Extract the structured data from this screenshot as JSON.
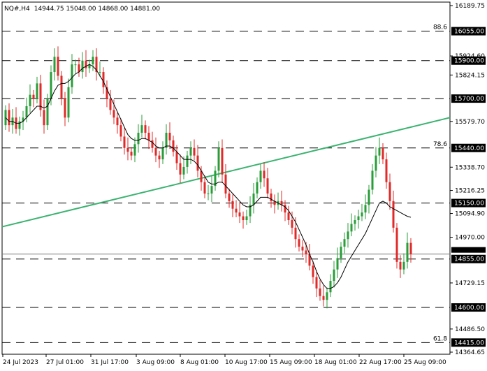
{
  "header": {
    "symbol_timeframe": "NQ#,H4",
    "ohlc": "14944.75 15048.00 14868.00 14881.00"
  },
  "colors": {
    "bull": "#2a9d3a",
    "bear": "#e02a2a",
    "trendline": "#3cb371",
    "ma": "#000000",
    "level_line": "#000000",
    "level_label_bg": "#000000",
    "level_label_text": "#ffffff"
  },
  "axis": {
    "price_ticks": [
      "16189.75",
      "15924.60",
      "15824.15",
      "15579.70",
      "15338.70",
      "15216.25",
      "15094.90",
      "14970.00",
      "14729.15",
      "14486.50",
      "14364.65"
    ],
    "date_ticks": [
      "24 Jul 2023",
      "27 Jul 01:00",
      "31 Jul 17:00",
      "3 Aug 09:00",
      "8 Aug 01:00",
      "10 Aug 17:00",
      "15 Aug 09:00",
      "18 Aug 01:00",
      "22 Aug 17:00",
      "25 Aug 09:00"
    ]
  },
  "levels": [
    {
      "price": "16055.00",
      "fib": "88.6"
    },
    {
      "price": "15900.00",
      "fib": ""
    },
    {
      "price": "15700.00",
      "fib": ""
    },
    {
      "price": "15440.00",
      "fib": "78.6"
    },
    {
      "price": "15150.00",
      "fib": ""
    },
    {
      "price": "14855.00",
      "fib": ""
    },
    {
      "price": "14600.00",
      "fib": ""
    },
    {
      "price": "14415.00",
      "fib": "61.8"
    }
  ],
  "current_price": "14881.00",
  "chart_data": {
    "type": "candlestick",
    "title": "NQ#,H4",
    "ylim": [
      14364.65,
      16189.75
    ],
    "closes": [
      15640,
      15560,
      15600,
      15540,
      15580,
      15600,
      15660,
      15720,
      15700,
      15780,
      15640,
      15560,
      15700,
      15840,
      15920,
      15820,
      15700,
      15600,
      15760,
      15880,
      15880,
      15840,
      15900,
      15860,
      15880,
      15920,
      15840,
      15840,
      15760,
      15700,
      15640,
      15600,
      15560,
      15500,
      15440,
      15420,
      15400,
      15460,
      15520,
      15560,
      15520,
      15480,
      15440,
      15400,
      15380,
      15440,
      15520,
      15480,
      15420,
      15360,
      15300,
      15340,
      15400,
      15440,
      15400,
      15320,
      15260,
      15200,
      15200,
      15240,
      15320,
      15440,
      15300,
      15200,
      15160,
      15120,
      15100,
      15080,
      15060,
      15080,
      15140,
      15200,
      15260,
      15320,
      15280,
      15200,
      15160,
      15140,
      15160,
      15140,
      15100,
      15060,
      15020,
      14960,
      14920,
      14900,
      14880,
      14820,
      14760,
      14700,
      14660,
      14640,
      14680,
      14740,
      14800,
      14860,
      14920,
      14960,
      15000,
      15040,
      15060,
      15080,
      15100,
      15140,
      15220,
      15320,
      15400,
      15440,
      15380,
      15260,
      15160,
      15020,
      14840,
      14800,
      14840,
      14940,
      14881
    ],
    "ma_values": [
      15600,
      15580,
      15580,
      15570,
      15570,
      15580,
      15600,
      15620,
      15640,
      15660,
      15660,
      15650,
      15660,
      15700,
      15740,
      15770,
      15780,
      15780,
      15790,
      15810,
      15830,
      15840,
      15860,
      15870,
      15880,
      15870,
      15850,
      15820,
      15790,
      15750,
      15710,
      15670,
      15630,
      15590,
      15550,
      15510,
      15490,
      15480,
      15480,
      15490,
      15490,
      15480,
      15470,
      15450,
      15440,
      15440,
      15450,
      15450,
      15440,
      15420,
      15400,
      15380,
      15380,
      15380,
      15370,
      15350,
      15320,
      15290,
      15260,
      15250,
      15250,
      15260,
      15260,
      15240,
      15220,
      15200,
      15180,
      15160,
      15140,
      15130,
      15130,
      15140,
      15160,
      15180,
      15180,
      15180,
      15170,
      15160,
      15150,
      15140,
      15130,
      15110,
      15080,
      15050,
      15010,
      14970,
      14930,
      14880,
      14840,
      14790,
      14750,
      14720,
      14700,
      14700,
      14710,
      14730,
      14760,
      14800,
      14840,
      14870,
      14900,
      14930,
      14960,
      14990,
      15030,
      15070,
      15110,
      15150,
      15160,
      15150,
      15130,
      15120,
      15110,
      15100,
      15090,
      15080,
      15075
    ],
    "trendline": {
      "from": 15025,
      "to": 15600
    },
    "x_ticks": [
      "24 Jul 2023",
      "27 Jul 01:00",
      "31 Jul 17:00",
      "3 Aug 09:00",
      "8 Aug 01:00",
      "10 Aug 17:00",
      "15 Aug 09:00",
      "18 Aug 01:00",
      "22 Aug 17:00",
      "25 Aug 09:00"
    ]
  }
}
